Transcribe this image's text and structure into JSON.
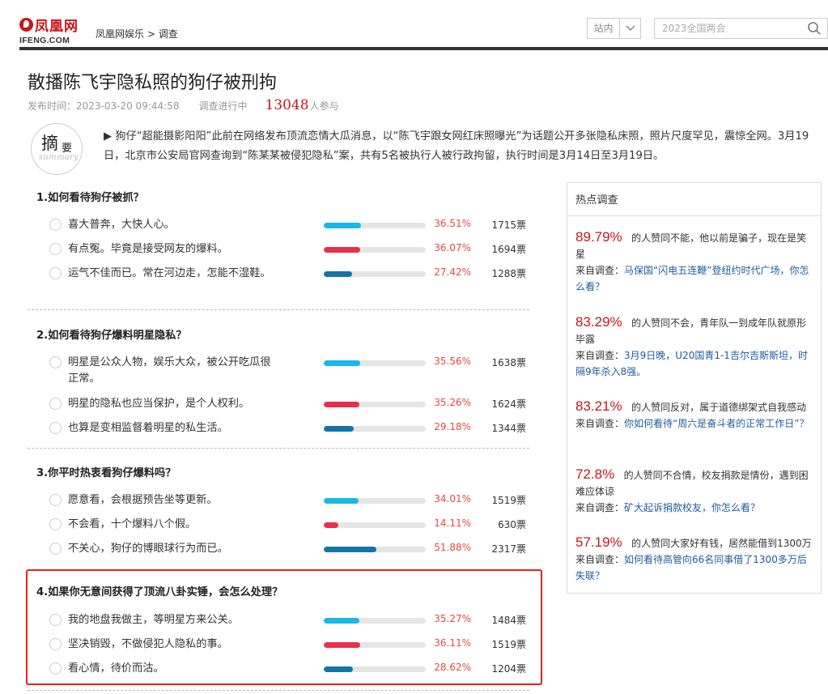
{
  "header": {
    "logo_cn": "凤凰网",
    "logo_en": "IFENG.COM",
    "breadcrumb": [
      "凤凰网娱乐",
      "调查"
    ],
    "breadcrumb_sep": ">",
    "site_select": "站内",
    "search_placeholder": "2023全国两会"
  },
  "article": {
    "title": "散播陈飞宇隐私照的狗仔被刑拘",
    "publish_time": "发布时间：2023-03-20 09:44:58",
    "status": "调查进行中",
    "participants": "13048",
    "participants_suffix": "人参与"
  },
  "summary": {
    "badge_main": "摘",
    "badge_sub": "要",
    "badge_en": "summary",
    "text": "▶ 狗仔“超能摄影阳阳”此前在网络发布顶流恋情大瓜消息，以“陈飞宇跟女网红床照曝光”为话题公开多张隐私床照，照片尺度罕见，震惊全网。3月19日，北京市公安局官网查询到“陈某某被侵犯隐私”案，共有5名被执行人被行政拘留，执行时间是3月14日至3月19日。"
  },
  "colors": {
    "cyan": "#1bb7ea",
    "red": "#e8304a",
    "blue": "#1574a6"
  },
  "questions": [
    {
      "title": "1.如何看待狗仔被抓？",
      "options": [
        {
          "label": "喜大普奔，大快人心。",
          "pct": "36.51%",
          "votes": "1715票",
          "ratio": 0.3651,
          "color": "cyan"
        },
        {
          "label": "有点冤。毕竟是接受网友的爆料。",
          "pct": "36.07%",
          "votes": "1694票",
          "ratio": 0.3607,
          "color": "red"
        },
        {
          "label": "运气不佳而已。常在河边走，怎能不湿鞋。",
          "pct": "27.42%",
          "votes": "1288票",
          "ratio": 0.2742,
          "color": "blue"
        }
      ]
    },
    {
      "title": "2.如何看待狗仔爆料明星隐私？",
      "options": [
        {
          "label": "明星是公众人物，娱乐大众，被公开吃瓜很正常。",
          "pct": "35.56%",
          "votes": "1638票",
          "ratio": 0.3556,
          "color": "cyan"
        },
        {
          "label": "明星的隐私也应当保护，是个人权利。",
          "pct": "35.26%",
          "votes": "1624票",
          "ratio": 0.3526,
          "color": "red"
        },
        {
          "label": "也算是变相监督着明星的私生活。",
          "pct": "29.18%",
          "votes": "1344票",
          "ratio": 0.2918,
          "color": "blue"
        }
      ]
    },
    {
      "title": "3.你平时热衷看狗仔爆料吗？",
      "options": [
        {
          "label": "愿意看，会根据预告坐等更新。",
          "pct": "34.01%",
          "votes": "1519票",
          "ratio": 0.3401,
          "color": "cyan"
        },
        {
          "label": "不会看，十个爆料八个假。",
          "pct": "14.11%",
          "votes": "630票",
          "ratio": 0.1411,
          "color": "red"
        },
        {
          "label": "不关心，狗仔的博眼球行为而已。",
          "pct": "51.88%",
          "votes": "2317票",
          "ratio": 0.5188,
          "color": "blue"
        }
      ]
    },
    {
      "title": "4.如果你无意间获得了顶流八卦实锤，会怎么处理？",
      "options": [
        {
          "label": "我的地盘我做主，等明星方来公关。",
          "pct": "35.27%",
          "votes": "1484票",
          "ratio": 0.3527,
          "color": "cyan"
        },
        {
          "label": "坚决销毁，不做侵犯人隐私的事。",
          "pct": "36.11%",
          "votes": "1519票",
          "ratio": 0.3611,
          "color": "red"
        },
        {
          "label": "看心情，待价而沽。",
          "pct": "28.62%",
          "votes": "1204票",
          "ratio": 0.2862,
          "color": "blue"
        }
      ]
    }
  ],
  "sidebar": {
    "title": "热点调查",
    "source_prefix": "来自调查：",
    "items": [
      {
        "pct": "89.79%",
        "text": "的人赞同不能，他以前是骗子，现在是笑星",
        "source": "马保国“闪电五连鞭”登纽约时代广场，你怎么看？"
      },
      {
        "pct": "83.29%",
        "text": "的人赞同不会，青年队一到成年队就原形毕露",
        "source": "3月9日晚，U20国青1-1吉尔吉斯斯坦，时隔9年杀入8强。"
      },
      {
        "pct": "83.21%",
        "text": "的人赞同反对，属于道德绑架式自我感动",
        "source": "你如何看待“周六是奋斗者的正常工作日”？"
      },
      {
        "pct": "72.8%",
        "text": "的人赞同不合情，校友捐款是情份，遇到困难应体谅",
        "source": "矿大起诉捐款校友，你怎么看？"
      },
      {
        "pct": "57.19%",
        "text": "的人赞同大家好有钱，居然能借到1300万",
        "source": "如何看待高管向66名同事借了1300多万后失联？"
      }
    ]
  }
}
